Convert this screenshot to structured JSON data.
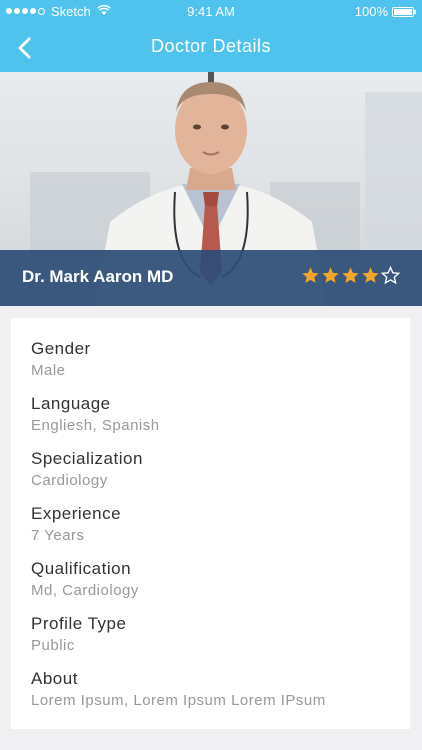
{
  "status_bar": {
    "carrier": "Sketch",
    "time": "9:41 AM",
    "battery": "100%"
  },
  "header": {
    "title": "Doctor Details"
  },
  "doctor": {
    "name": "Dr. Mark Aaron MD",
    "rating": 4,
    "rating_max": 5
  },
  "colors": {
    "header": "#4fc3ee",
    "name_bar": "#2c4c76",
    "star": "#f4a62a"
  },
  "details": [
    {
      "label": "Gender",
      "value": "Male"
    },
    {
      "label": "Language",
      "value": "Engliesh, Spanish"
    },
    {
      "label": "Specialization",
      "value": "Cardiology"
    },
    {
      "label": "Experience",
      "value": "7 Years"
    },
    {
      "label": "Qualification",
      "value": "Md, Cardiology"
    },
    {
      "label": "Profile Type",
      "value": "Public"
    },
    {
      "label": "About",
      "value": "Lorem Ipsum, Lorem Ipsum Lorem IPsum"
    }
  ]
}
